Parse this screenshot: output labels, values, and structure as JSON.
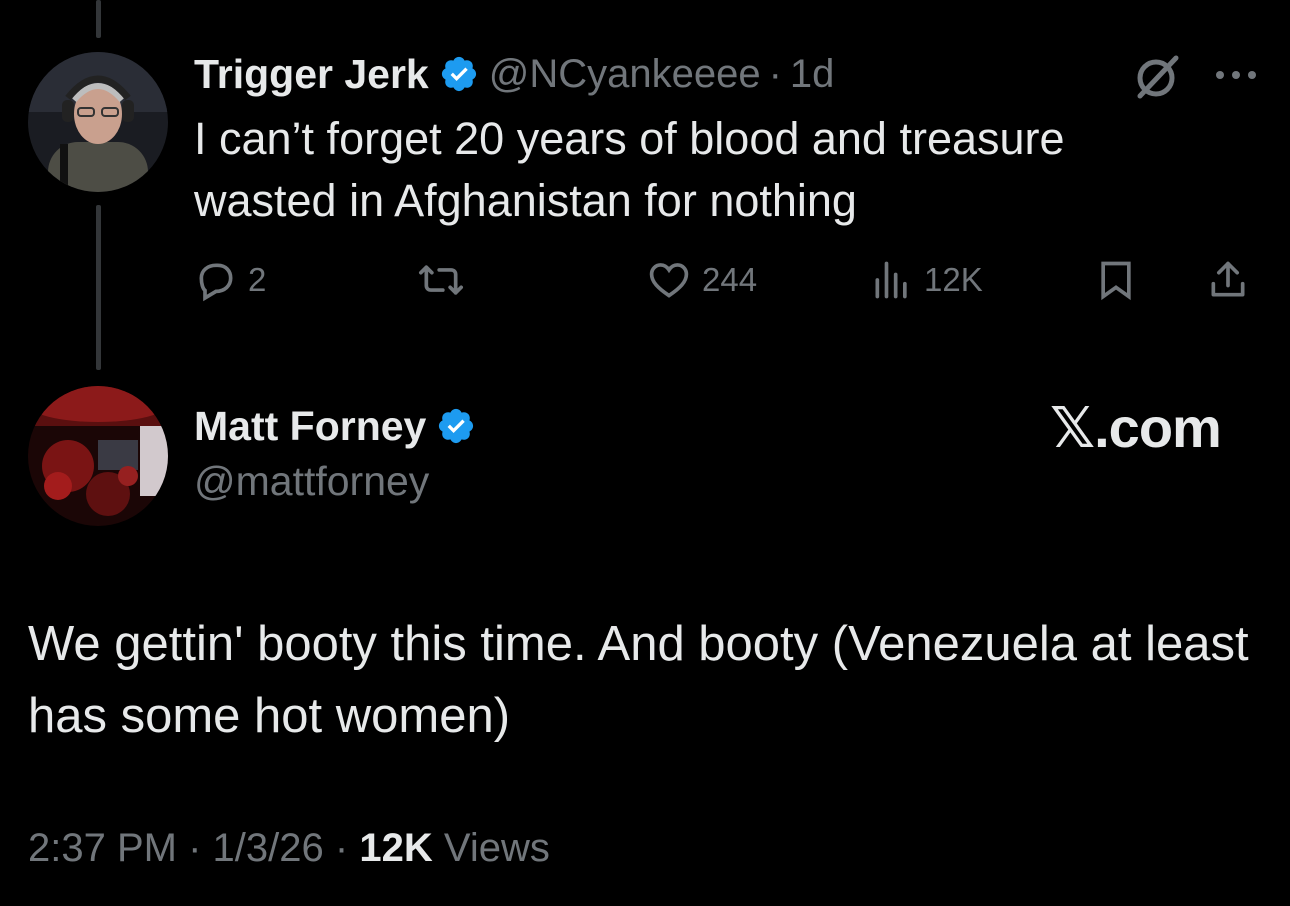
{
  "parent_tweet": {
    "author_name": "Trigger Jerk",
    "handle": "@NCyankeeee",
    "separator": "·",
    "time_ago": "1d",
    "text": "I can’t forget 20 years of blood and treasure wasted in Afghanistan for nothing",
    "avatar_icon": "user-avatar-photo",
    "verified_icon": "verified-badge-icon",
    "actions": {
      "replies": "2",
      "reposts": "",
      "likes": "244",
      "views": "12K"
    }
  },
  "main_tweet": {
    "author_name": "Matt Forney",
    "handle": "@mattforney",
    "brand": "𝕏.com",
    "text": "We gettin' booty this time. And booty (Venezuela at least has some hot women)",
    "timestamp": "2:37 PM",
    "date": "1/3/26",
    "separator": "·",
    "views_count": "12K",
    "views_label": "Views"
  },
  "colors": {
    "background": "#000000",
    "text": "#e7e9ea",
    "muted": "#71767b",
    "verified": "#1d9bf0"
  }
}
